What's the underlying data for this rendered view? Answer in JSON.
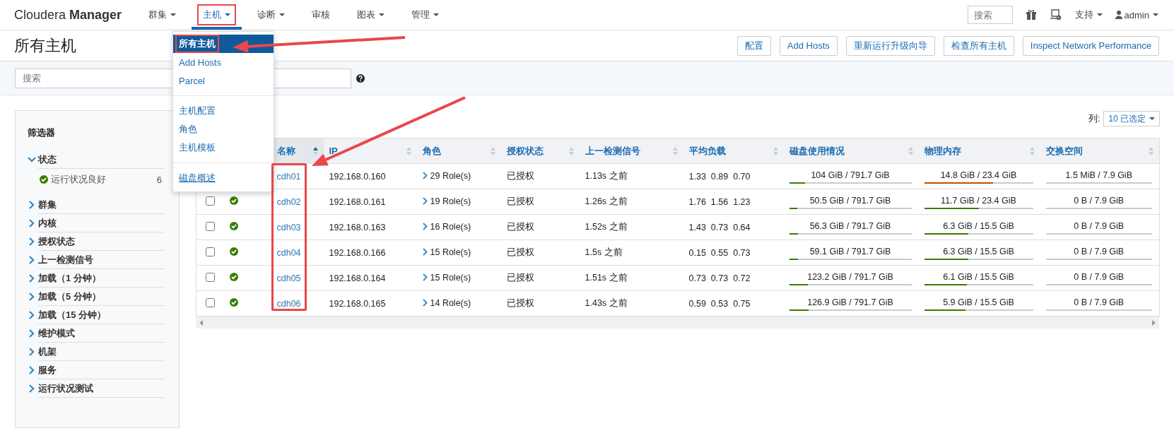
{
  "navbar": {
    "brand_light": "Cloudera",
    "brand_bold": "Manager",
    "items": [
      {
        "label": "群集",
        "dropdown": true,
        "selected": false,
        "highlighted": false
      },
      {
        "label": "主机",
        "dropdown": true,
        "selected": true,
        "highlighted": true
      },
      {
        "label": "诊断",
        "dropdown": true,
        "selected": false,
        "highlighted": false
      },
      {
        "label": "审核",
        "dropdown": false,
        "selected": false,
        "highlighted": false
      },
      {
        "label": "图表",
        "dropdown": true,
        "selected": false,
        "highlighted": false
      },
      {
        "label": "管理",
        "dropdown": true,
        "selected": false,
        "highlighted": false
      }
    ],
    "search": {
      "placeholder": "搜索"
    },
    "support": "支持",
    "user": "admin"
  },
  "page": {
    "title": "所有主机",
    "actions": [
      "配置",
      "Add Hosts",
      "重新运行升级向导",
      "检查所有主机",
      "Inspect Network Performance"
    ]
  },
  "search": {
    "placeholder": "搜索"
  },
  "filters": {
    "title": "筛选器",
    "sections": [
      {
        "label": "状态",
        "expanded": true,
        "children": [
          {
            "label": "运行状况良好",
            "count": "6"
          }
        ]
      },
      {
        "label": "群集",
        "expanded": false
      },
      {
        "label": "内核",
        "expanded": false
      },
      {
        "label": "授权状态",
        "expanded": false
      },
      {
        "label": "上一检测信号",
        "expanded": false
      },
      {
        "label": "加载（1 分钟）",
        "expanded": false
      },
      {
        "label": "加载（5 分钟）",
        "expanded": false
      },
      {
        "label": "加载（15 分钟）",
        "expanded": false
      },
      {
        "label": "维护模式",
        "expanded": false
      },
      {
        "label": "机架",
        "expanded": false
      },
      {
        "label": "服务",
        "expanded": false
      },
      {
        "label": "运行状况测试",
        "expanded": false
      }
    ]
  },
  "columns_selector": {
    "label": "列:",
    "value": "10 已选定"
  },
  "table": {
    "columns": [
      {
        "label": "名称",
        "sorted": true
      },
      {
        "label": "IP",
        "sorted": false
      },
      {
        "label": "角色",
        "sorted": false
      },
      {
        "label": "授权状态",
        "sorted": false
      },
      {
        "label": "上一检测信号",
        "sorted": false
      },
      {
        "label": "平均负载",
        "sorted": false
      },
      {
        "label": "磁盘使用情况",
        "sorted": false
      },
      {
        "label": "物理内存",
        "sorted": false
      },
      {
        "label": "交换空间",
        "sorted": false
      }
    ],
    "rows": [
      {
        "name": "cdh01",
        "ip": "192.168.0.160",
        "roles": "29 Role(s)",
        "authorization": "已授权",
        "last_heartbeat": "1.13s 之前",
        "load": [
          "1.33",
          "0.89",
          "0.70"
        ],
        "disk": {
          "text": "104 GiB / 791.7 GiB",
          "level": 0.131,
          "color": "#3a7d00"
        },
        "memory": {
          "text": "14.8 GiB / 23.4 GiB",
          "level": 0.632,
          "color": "#c05000"
        },
        "swap": {
          "text": "1.5 MiB / 7.9 GiB"
        }
      },
      {
        "checked": false,
        "healthy": true,
        "name": "cdh02",
        "ip": "192.168.0.161",
        "roles": "19 Role(s)",
        "authorization": "已授权",
        "last_heartbeat": "1.26s 之前",
        "load": [
          "1.76",
          "1.56",
          "1.23"
        ],
        "disk": {
          "text": "50.5 GiB / 791.7 GiB",
          "level": 0.064,
          "color": "#3a7d00"
        },
        "memory": {
          "text": "11.7 GiB / 23.4 GiB",
          "level": 0.5,
          "color": "#3a7d00"
        },
        "swap": {
          "text": "0 B / 7.9 GiB"
        }
      },
      {
        "checked": false,
        "healthy": true,
        "name": "cdh03",
        "ip": "192.168.0.163",
        "roles": "16 Role(s)",
        "authorization": "已授权",
        "last_heartbeat": "1.52s 之前",
        "load": [
          "1.43",
          "0.73",
          "0.64"
        ],
        "disk": {
          "text": "56.3 GiB / 791.7 GiB",
          "level": 0.071,
          "color": "#3a7d00"
        },
        "memory": {
          "text": "6.3 GiB / 15.5 GiB",
          "level": 0.406,
          "color": "#3a7d00"
        },
        "swap": {
          "text": "0 B / 7.9 GiB"
        }
      },
      {
        "checked": false,
        "healthy": true,
        "name": "cdh04",
        "ip": "192.168.0.166",
        "roles": "15 Role(s)",
        "authorization": "已授权",
        "last_heartbeat": "1.5s 之前",
        "load": [
          "0.15",
          "0.55",
          "0.73"
        ],
        "disk": {
          "text": "59.1 GiB / 791.7 GiB",
          "level": 0.075,
          "color": "#3a7d00"
        },
        "memory": {
          "text": "6.3 GiB / 15.5 GiB",
          "level": 0.406,
          "color": "#3a7d00"
        },
        "swap": {
          "text": "0 B / 7.9 GiB"
        }
      },
      {
        "checked": false,
        "healthy": true,
        "name": "cdh05",
        "ip": "192.168.0.164",
        "roles": "15 Role(s)",
        "authorization": "已授权",
        "last_heartbeat": "1.51s 之前",
        "load": [
          "0.73",
          "0.73",
          "0.72"
        ],
        "disk": {
          "text": "123.2 GiB / 791.7 GiB",
          "level": 0.156,
          "color": "#3a7d00"
        },
        "memory": {
          "text": "6.1 GiB / 15.5 GiB",
          "level": 0.394,
          "color": "#3a7d00"
        },
        "swap": {
          "text": "0 B / 7.9 GiB"
        }
      },
      {
        "checked": false,
        "healthy": true,
        "name": "cdh06",
        "ip": "192.168.0.165",
        "roles": "14 Role(s)",
        "authorization": "已授权",
        "last_heartbeat": "1.43s 之前",
        "load": [
          "0.59",
          "0.53",
          "0.75"
        ],
        "disk": {
          "text": "126.9 GiB / 791.7 GiB",
          "level": 0.16,
          "color": "#3a7d00"
        },
        "memory": {
          "text": "5.9 GiB / 15.5 GiB",
          "level": 0.381,
          "color": "#3a7d00"
        },
        "swap": {
          "text": "0 B / 7.9 GiB"
        }
      }
    ]
  },
  "menu": {
    "items": [
      {
        "kind": "item",
        "label": "所有主机",
        "selected": true,
        "highlighted": true,
        "hovered": false
      },
      {
        "kind": "item",
        "label": "Add Hosts",
        "selected": false,
        "highlighted": false,
        "hovered": false
      },
      {
        "kind": "item",
        "label": "Parcel",
        "selected": false,
        "highlighted": false,
        "hovered": false
      },
      {
        "kind": "divider"
      },
      {
        "kind": "item",
        "label": "主机配置",
        "selected": false,
        "highlighted": false,
        "hovered": false
      },
      {
        "kind": "item",
        "label": "角色",
        "selected": false,
        "highlighted": false,
        "hovered": false
      },
      {
        "kind": "item",
        "label": "主机模板",
        "selected": false,
        "highlighted": false,
        "hovered": false
      },
      {
        "kind": "divider"
      },
      {
        "kind": "item",
        "label": "磁盘概述",
        "selected": false,
        "highlighted": false,
        "hovered": true
      }
    ]
  }
}
